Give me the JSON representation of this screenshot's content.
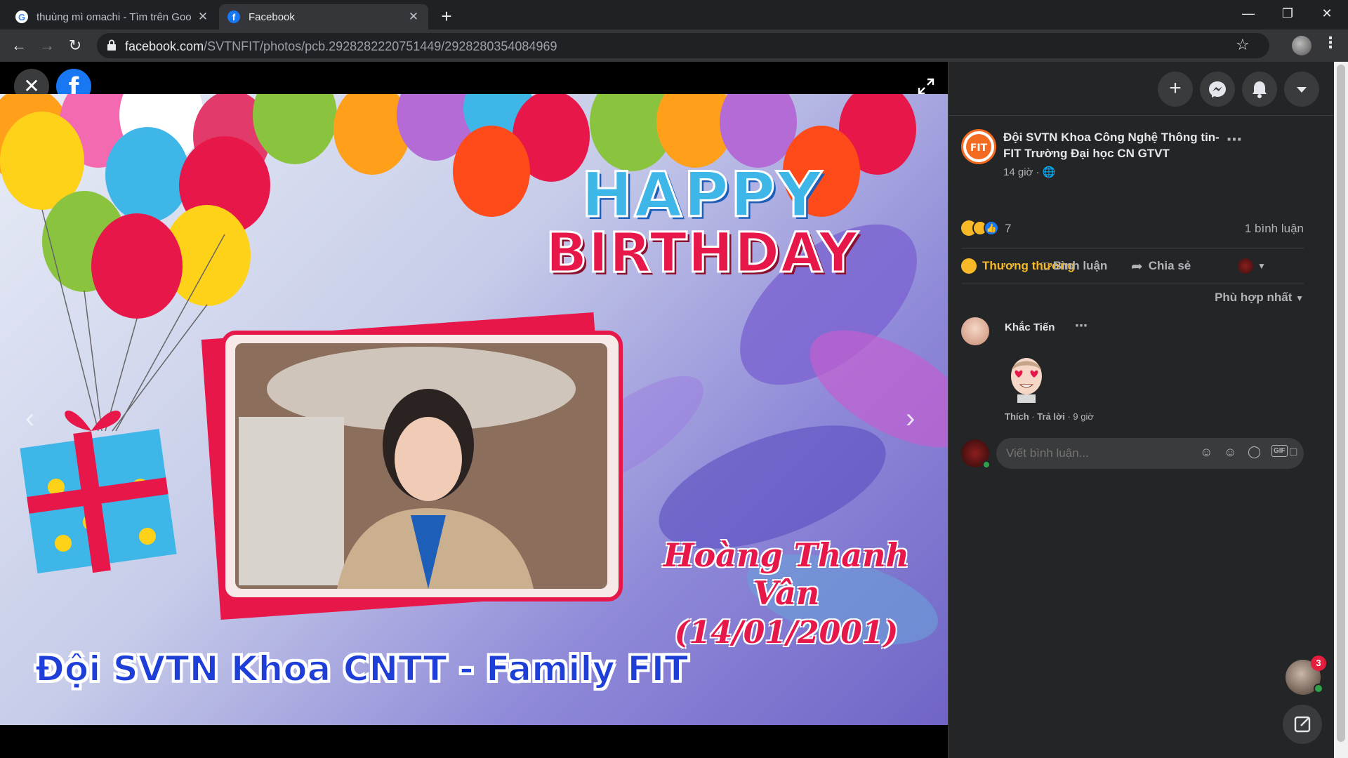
{
  "browser": {
    "tabs": [
      {
        "title": "thuùng mì omachi - Tìm trên Goo",
        "favicon": "google-icon",
        "active": false
      },
      {
        "title": "Facebook",
        "favicon": "facebook-icon",
        "active": true
      }
    ],
    "url_host": "facebook.com",
    "url_path": "/SVTNFIT/photos/pcb.2928282220751449/2928280354084969"
  },
  "photo": {
    "greeting_line1": "HAPPY",
    "greeting_line2": "BIRTHDAY",
    "name": "Hoàng Thanh Vân",
    "date": "(14/01/2001)",
    "banner": "Đội SVTN Khoa CNTT - Family FIT"
  },
  "post": {
    "page_name": "Đội SVTN Khoa Công Nghệ Thông tin-FIT Trường Đại học CN GTVT",
    "time": "14 giờ",
    "reaction_count": "7",
    "comment_count": "1 bình luận",
    "action_react": "Thương thương",
    "action_comment": "Bình luận",
    "action_share": "Chia sẻ",
    "sort_label": "Phù hợp nhất"
  },
  "comment": {
    "author": "Khắc Tiến",
    "like": "Thích",
    "reply": "Trả lời",
    "time": "9 giờ"
  },
  "composer": {
    "placeholder": "Viết bình luận..."
  },
  "chat": {
    "badge": "3"
  },
  "colors": {
    "fb_blue": "#1877f2",
    "reaction_orange": "#f7b928"
  }
}
